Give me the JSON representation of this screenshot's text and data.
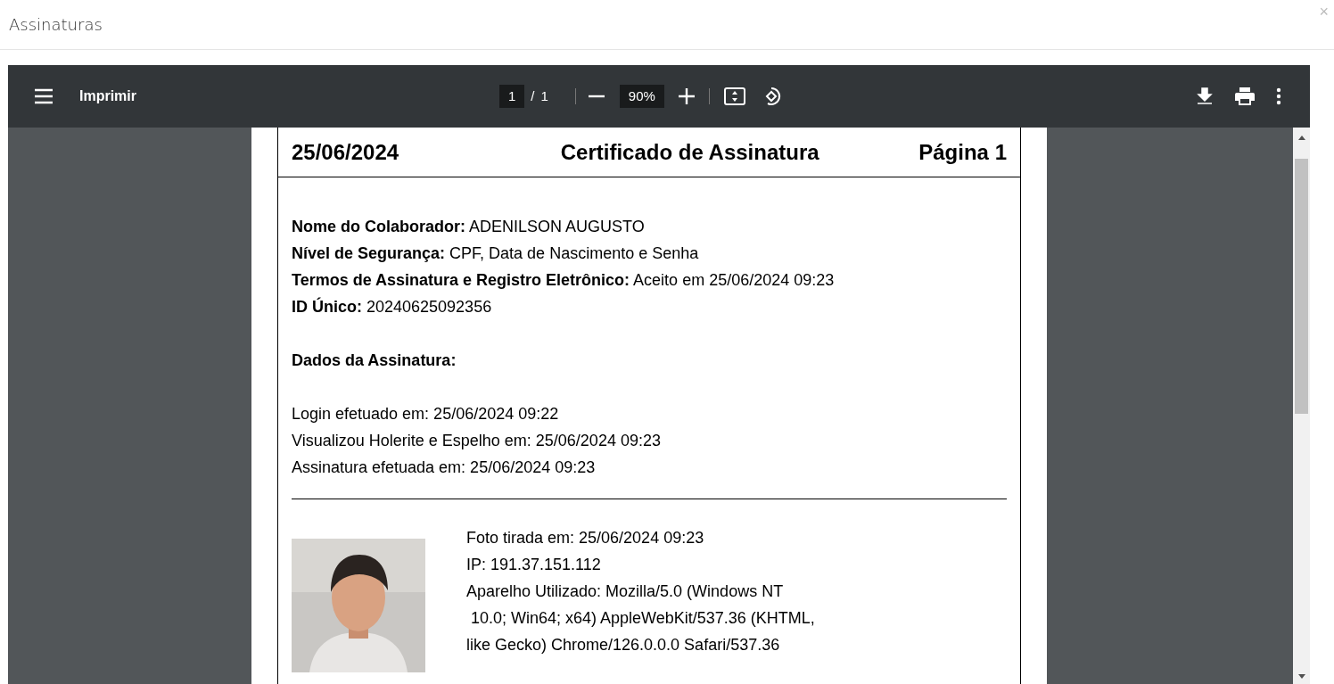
{
  "dialog": {
    "title": "Assinaturas",
    "close": "×"
  },
  "viewer": {
    "title": "Imprimir",
    "page_current": "1",
    "page_separator": "/",
    "page_total": "1",
    "zoom": "90%"
  },
  "document": {
    "header": {
      "date": "25/06/2024",
      "title": "Certificado de Assinatura",
      "page": "Página 1"
    },
    "fields": [
      "**Nome do Colaborador:** ADENILSON AUGUSTO",
      "**Nível de Segurança:** CPF, Data de Nascimento e Senha",
      "**Termos de Assinatura e Registro Eletrônico:** Aceito em 25/06/2024 09:23",
      "**ID Único:** 20240625092356"
    ],
    "section_title": "Dados da Assinatura:",
    "events": [
      "Login efetuado em: 25/06/2024 09:22",
      "Visualizou Holerite e Espelho em: 25/06/2024 09:23",
      "Assinatura efetuada em: 25/06/2024 09:23"
    ],
    "photo": {
      "kind": "picture"
    },
    "photo_info": [
      "Foto tirada em: 25/06/2024 09:23",
      "IP: 191.37.151.112",
      "Aparelho Utilizado: Mozilla/5.0 (Windows NT",
      "10.0; Win64; x64) AppleWebKit/537.36 (KHTML,",
      "like Gecko) Chrome/126.0.0.0 Safari/537.36"
    ]
  }
}
